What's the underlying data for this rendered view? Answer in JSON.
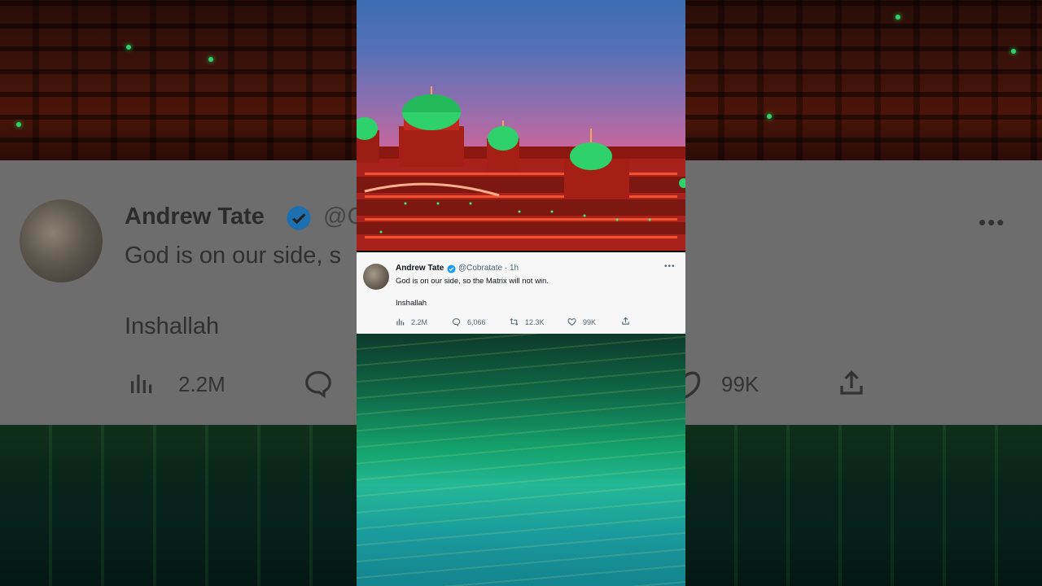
{
  "tweet": {
    "name": "Andrew Tate",
    "handle": "@Cobratate",
    "time": "1h",
    "separator": "·",
    "text": "God is on our side, so the Matrix will not win.",
    "text2": "Inshallah",
    "views": "2.2M",
    "replies": "6,066",
    "retweets": "12.3K",
    "likes": "99K",
    "more": "•••"
  },
  "background_zoom": {
    "name": "Andrew Tate",
    "handle_partial": "@C",
    "text_partial": "God is on our side, s",
    "text2": "Inshallah",
    "views": "2.2M",
    "likes": "99K",
    "more": "•••"
  },
  "colors": {
    "verified": "#1d9bf0",
    "tweet_bg": "#f7f7f7",
    "dome_green": "#2fd26a",
    "palace_red": "#c0281e"
  },
  "icons": [
    "verified-icon",
    "views-icon",
    "reply-icon",
    "retweet-icon",
    "like-icon",
    "share-icon",
    "more-icon"
  ]
}
